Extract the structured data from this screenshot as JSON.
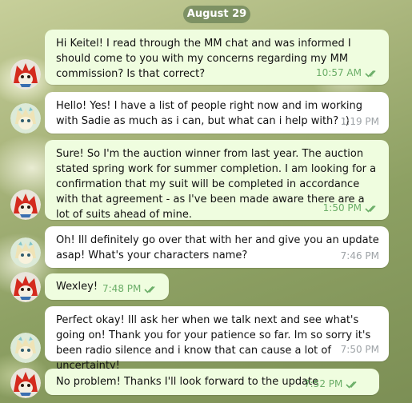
{
  "chat": {
    "date_label": "August 29",
    "messages": [
      {
        "direction": "out",
        "text": "Hi Keitel! I read through the MM chat and was informed I should come to you with my concerns regarding my MM commission? Is that correct?",
        "time": "10:57 AM",
        "read": true
      },
      {
        "direction": "in",
        "text": "Hello! Yes! I have a list of people right now and im working with Sadie as much as i can, but what can i help with? :)",
        "time": "1:19 PM"
      },
      {
        "direction": "out",
        "text": "Sure! So I'm the auction winner from last year. The auction stated spring work for summer completion. I am looking for a confirmation that my suit will be completed in accordance with that agreement - as I've been made aware there are a lot of suits ahead of mine.",
        "time": "1:50 PM",
        "read": true
      },
      {
        "direction": "in",
        "text": "Oh! Ill definitely go over that with her and give you an update asap! What's your characters name?",
        "time": "7:46 PM"
      },
      {
        "direction": "out",
        "text": "Wexley!",
        "time": "7:48 PM",
        "read": true
      },
      {
        "direction": "in",
        "text": "Perfect okay! Ill ask her when we talk next and see what's going on! Thank you for your patience so far. Im so sorry it's been radio silence and i know that can cause a lot of uncertainty!",
        "time": "7:50 PM"
      },
      {
        "direction": "out",
        "text": "No problem! Thanks I'll look forward to the update",
        "time": "7:52 PM",
        "read": true
      }
    ]
  },
  "colors": {
    "outgoing_bubble": "#effddf",
    "incoming_bubble": "#ffffff",
    "outgoing_meta": "#6bae68",
    "incoming_meta": "#9ea3a7",
    "date_pill": "#667e54"
  },
  "icons": {
    "read_receipt": "double-check-icon",
    "sender_avatar": "red-character-avatar",
    "recipient_avatar": "cream-character-avatar"
  }
}
